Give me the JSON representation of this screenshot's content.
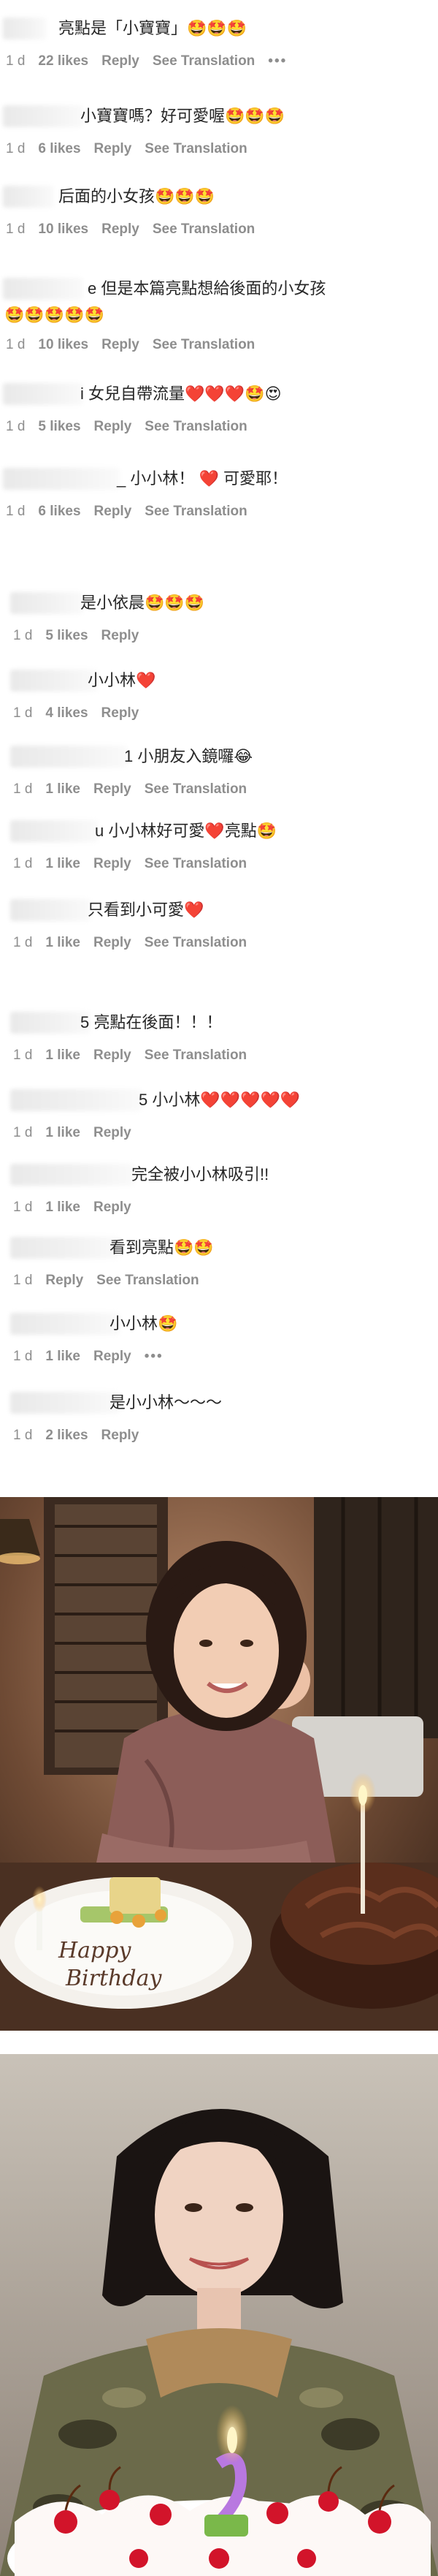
{
  "comments": [
    {
      "text": "亮點是「小寶寶」🤩🤩🤩",
      "time": "1 d",
      "likes": "22 likes",
      "reply": "Reply",
      "translate": "See Translation",
      "more": "•••"
    },
    {
      "text": "小寶寶嗎？好可愛喔🤩🤩🤩",
      "time": "1 d",
      "likes": "6 likes",
      "reply": "Reply",
      "translate": "See Translation"
    },
    {
      "text": "后面的小女孩🤩🤩🤩",
      "time": "1 d",
      "likes": "10 likes",
      "reply": "Reply",
      "translate": "See Translation"
    },
    {
      "text": "e 但是本篇亮點想給後面的小女孩",
      "text2": "🤩🤩🤩🤩🤩",
      "time": "1 d",
      "likes": "10 likes",
      "reply": "Reply",
      "translate": "See Translation"
    },
    {
      "text": "i 女兒自帶流量❤️❤️❤️🤩😍",
      "time": "1 d",
      "likes": "5 likes",
      "reply": "Reply",
      "translate": "See Translation"
    },
    {
      "text": "_ 小小林！ ❤️ 可愛耶！",
      "time": "1 d",
      "likes": "6 likes",
      "reply": "Reply",
      "translate": "See Translation"
    },
    {
      "text": "是小依晨🤩🤩🤩",
      "time": "1 d",
      "likes": "5 likes",
      "reply": "Reply"
    },
    {
      "text": "小小林❤️",
      "time": "1 d",
      "likes": "4 likes",
      "reply": "Reply"
    },
    {
      "text": "1 小朋友入鏡囉😂",
      "time": "1 d",
      "likes": "1 like",
      "reply": "Reply",
      "translate": "See Translation"
    },
    {
      "text": "u 小小林好可愛❤️亮點🤩",
      "time": "1 d",
      "likes": "1 like",
      "reply": "Reply",
      "translate": "See Translation"
    },
    {
      "text": "只看到小可愛❤️",
      "time": "1 d",
      "likes": "1 like",
      "reply": "Reply",
      "translate": "See Translation"
    },
    {
      "text": "5 亮點在後面！！！",
      "time": "1 d",
      "likes": "1 like",
      "reply": "Reply",
      "translate": "See Translation"
    },
    {
      "text": "5 小小林❤️❤️❤️❤️❤️",
      "time": "1 d",
      "likes": "1 like",
      "reply": "Reply"
    },
    {
      "text": "完全被小小林吸引!!",
      "time": "1 d",
      "likes": "1 like",
      "reply": "Reply"
    },
    {
      "text": "看到亮點🤩🤩",
      "time": "1 d",
      "likes": "",
      "reply": "Reply",
      "translate": "See Translation"
    },
    {
      "text": "小小林🤩",
      "time": "1 d",
      "likes": "1 like",
      "reply": "Reply",
      "more": "•••"
    },
    {
      "text": "是小小林～～～",
      "time": "1 d",
      "likes": "2 likes",
      "reply": "Reply"
    }
  ],
  "photo1": {
    "cake_text_1": "Happy",
    "cake_text_2": "Birthday"
  },
  "colors": {
    "meta_gray": "#8e8e8e",
    "text": "#262626",
    "heart": "#ed1c24"
  }
}
